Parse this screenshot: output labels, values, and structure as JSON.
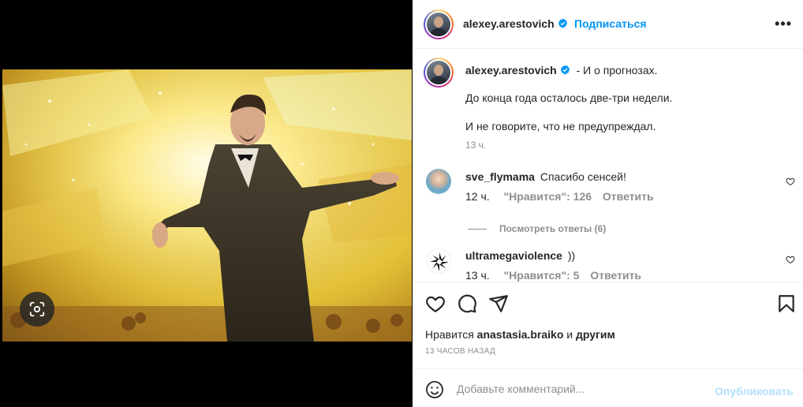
{
  "post": {
    "author": "alexey.arestovich",
    "follow_label": "Подписаться",
    "more_label": "•••"
  },
  "caption": {
    "author": "alexey.arestovich",
    "line1": "- И о прогнозах.",
    "line2": "До конца года осталось две-три недели.",
    "line3": "И не говорите, что не предупреждал.",
    "age": "13 ч."
  },
  "comments": [
    {
      "user": "sve_flymama",
      "text": "Спасибо сенсей!",
      "age": "12 ч.",
      "likes_label": "\"Нравится\": 126",
      "reply_label": "Ответить"
    },
    {
      "user": "ultramegaviolence",
      "text": "))",
      "age": "13 ч.",
      "likes_label": "\"Нравится\": 5",
      "reply_label": "Ответить"
    }
  ],
  "view_replies": "Посмотреть ответы (6)",
  "likes": {
    "prefix": "Нравится",
    "user": "anastasia.braiko",
    "connector": "и",
    "suffix": "другим"
  },
  "timestamp": "13 ЧАСОВ НАЗАД",
  "add_comment": {
    "placeholder": "Добавьте комментарий...",
    "publish_label": "Опубликовать"
  },
  "icons": {
    "lens": "visual-search-icon",
    "heart": "heart-icon",
    "comment": "comment-icon",
    "share": "share-icon",
    "save": "bookmark-icon",
    "emoji": "emoji-icon",
    "verified": "verified-badge-icon"
  },
  "colors": {
    "accent": "#0095f6",
    "accent_disabled": "#b2dffc",
    "muted": "#8e8e8e",
    "text": "#262626"
  }
}
